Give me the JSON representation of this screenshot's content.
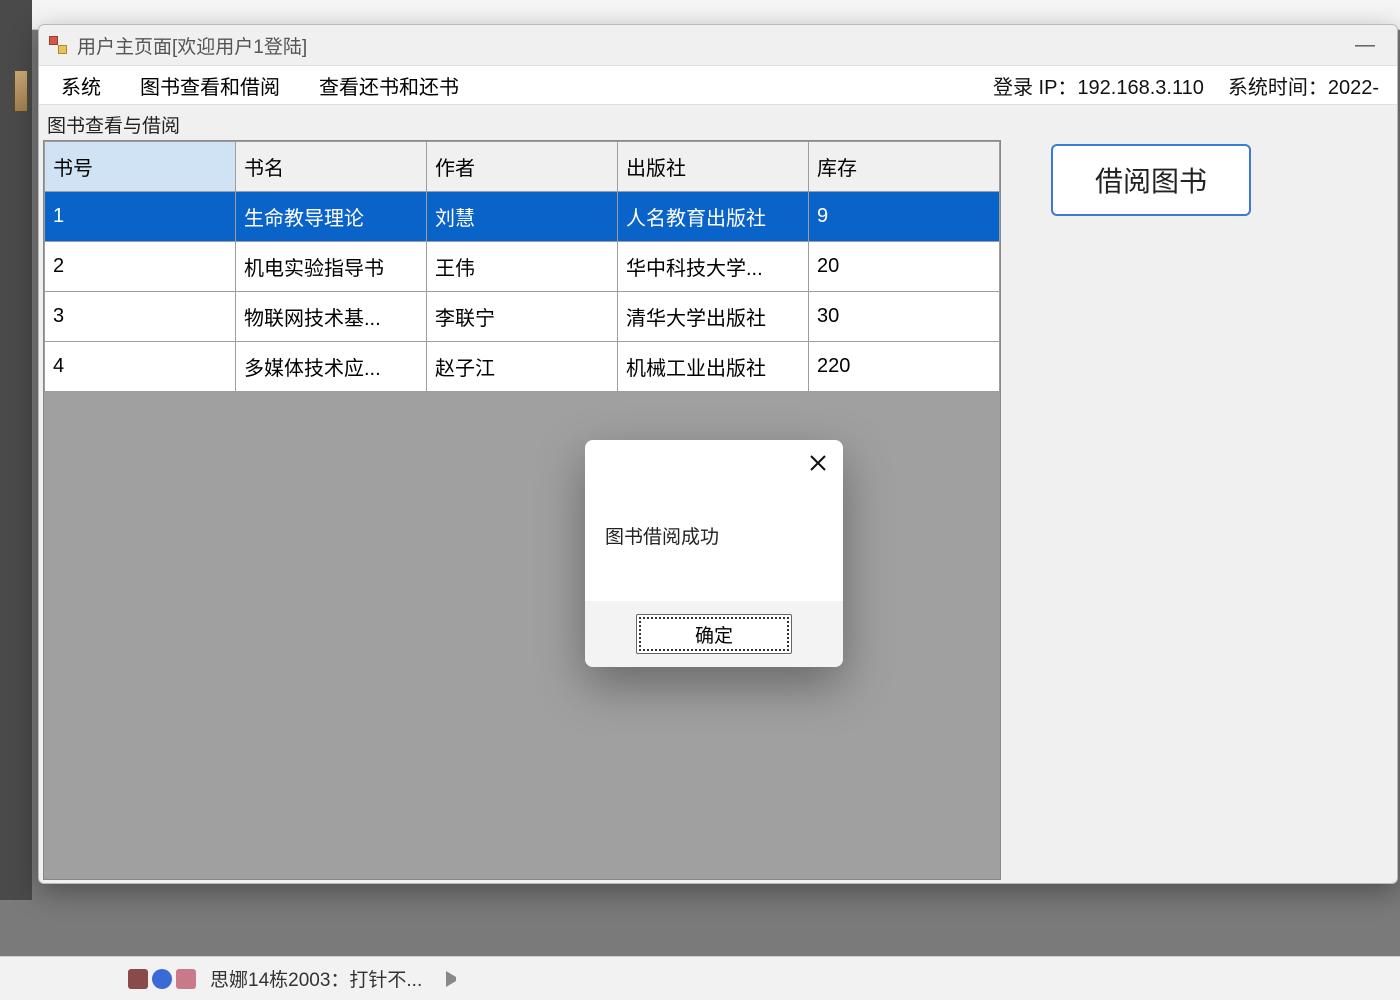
{
  "window": {
    "title": "用户主页面[欢迎用户1登陆]",
    "minimize_glyph": "—"
  },
  "menubar": {
    "system": "系统",
    "view_borrow": "图书查看和借阅",
    "view_return": "查看还书和还书",
    "login_ip_label": "登录 IP：",
    "login_ip_value": "192.168.3.110",
    "systime_label": "系统时间：",
    "systime_value": "2022-"
  },
  "section": {
    "label": "图书查看与借阅"
  },
  "table": {
    "columns": {
      "id": "书号",
      "name": "书名",
      "author": "作者",
      "publisher": "出版社",
      "stock": "库存"
    },
    "rows": [
      {
        "id": "1",
        "name": "生命教导理论",
        "author": "刘慧",
        "publisher": "人名教育出版社",
        "stock": "9",
        "selected": true
      },
      {
        "id": "2",
        "name": "机电实验指导书",
        "author": "王伟",
        "publisher": "华中科技大学...",
        "stock": "20",
        "selected": false
      },
      {
        "id": "3",
        "name": "物联网技术基...",
        "author": "李联宁",
        "publisher": "清华大学出版社",
        "stock": "30",
        "selected": false
      },
      {
        "id": "4",
        "name": "多媒体技术应...",
        "author": "赵子江",
        "publisher": "机械工业出版社",
        "stock": "220",
        "selected": false
      }
    ]
  },
  "actions": {
    "borrow_label": "借阅图书"
  },
  "dialog": {
    "message": "图书借阅成功",
    "ok_label": "确定"
  },
  "taskbar": {
    "notification": "思娜14栋2003：打针不..."
  }
}
